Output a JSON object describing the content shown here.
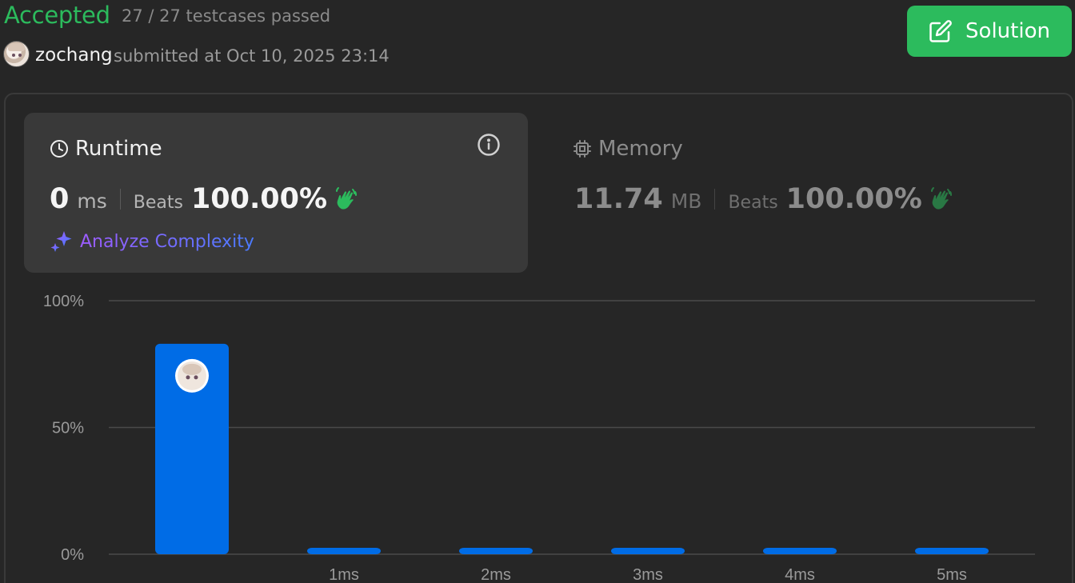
{
  "header": {
    "status": "Accepted",
    "testcases": "27 / 27 testcases passed",
    "username": "zochang",
    "submitted": "submitted at Oct 10, 2025 23:14",
    "solution_label": "Solution"
  },
  "runtime": {
    "title": "Runtime",
    "value": "0",
    "unit": "ms",
    "beats_label": "Beats",
    "beats_value": "100.00%",
    "analyze_label": "Analyze Complexity"
  },
  "memory": {
    "title": "Memory",
    "value": "11.74",
    "unit": "MB",
    "beats_label": "Beats",
    "beats_value": "100.00%"
  },
  "colors": {
    "accepted": "#2cbb5d",
    "bar": "#006ce6",
    "panel": "#393939"
  },
  "chart_data": {
    "type": "bar",
    "categories": [
      "",
      "1ms",
      "2ms",
      "3ms",
      "4ms",
      "5ms"
    ],
    "values": [
      83,
      2,
      2,
      2,
      2,
      2
    ],
    "ylim": [
      0,
      100
    ],
    "yticks": [
      "100%",
      "50%",
      "0%"
    ],
    "ytick_values": [
      100,
      50,
      0
    ],
    "grid": true,
    "marker_on_category": 0
  }
}
